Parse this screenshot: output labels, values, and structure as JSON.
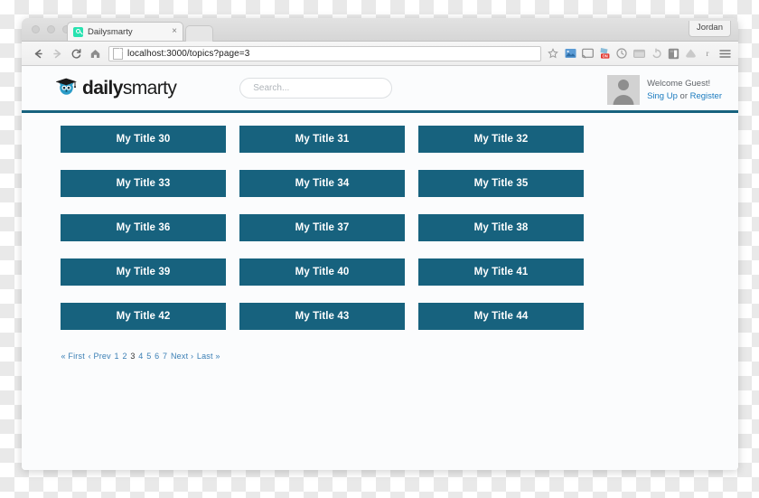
{
  "browser": {
    "tab": {
      "title": "Dailysmarty",
      "favicon": "dailysmarty-favicon",
      "close_label": "×"
    },
    "profile": {
      "name": "Jordan"
    },
    "toolbar": {
      "back_label": "back-arrow",
      "forward_label": "forward-arrow",
      "reload_label": "reload",
      "home_label": "home",
      "url": "localhost:3000/topics?page=3",
      "bookmark_label": "star",
      "extensions": [
        "photo-extension-icon",
        "cast-extension-icon",
        "honey-extension-icon",
        "clock-extension-icon",
        "window-extension-icon",
        "link-extension-icon",
        "evernote-extension-icon",
        "drive-extension-icon",
        "r-extension-icon",
        "menu-icon"
      ]
    }
  },
  "site": {
    "brand": {
      "bold": "daily",
      "light": "smarty",
      "icon": "owl-graduate-icon"
    },
    "search": {
      "placeholder": "Search...",
      "value": ""
    },
    "user": {
      "welcome": "Welcome Guest!",
      "signup_label": "Sing Up",
      "or_label": "or",
      "register_label": "Register",
      "avatar": "guest-avatar"
    },
    "accent_color": "#17627e",
    "link_color": "#1b7bbf"
  },
  "main": {
    "cards": [
      "My Title 30",
      "My Title 31",
      "My Title 32",
      "My Title 33",
      "My Title 34",
      "My Title 35",
      "My Title 36",
      "My Title 37",
      "My Title 38",
      "My Title 39",
      "My Title 40",
      "My Title 41",
      "My Title 42",
      "My Title 43",
      "My Title 44"
    ],
    "pagination": {
      "first": "« First",
      "prev": "‹ Prev",
      "pages": [
        "1",
        "2",
        "3",
        "4",
        "5",
        "6",
        "7"
      ],
      "current": "3",
      "next": "Next ›",
      "last": "Last »"
    }
  }
}
